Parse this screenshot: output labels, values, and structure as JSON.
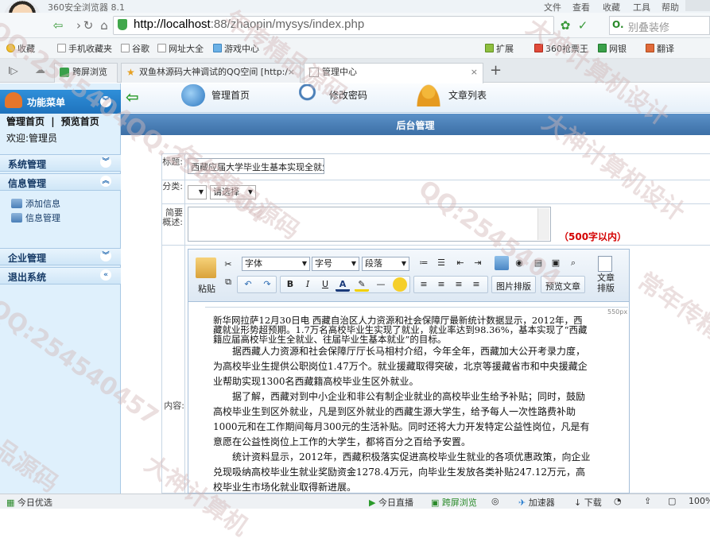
{
  "browser": {
    "app_title": "360安全浏览器 8.1",
    "window_menu": [
      "文件",
      "查看",
      "收藏",
      "工具",
      "帮助"
    ],
    "address": {
      "host": "http://localhost",
      "path": ":88/zhaopin/mysys/index.php"
    },
    "search_placeholder": "别叠装修",
    "bookmarks": [
      "收藏",
      "手机收藏夹",
      "谷歌",
      "网址大全",
      "游戏中心",
      "扩展",
      "360抢票王",
      "网银",
      "翻译"
    ],
    "tabs": [
      {
        "label": "跨屏浏览"
      },
      {
        "label": "双鱼林源码大神调试的QQ空间 [http:/"
      },
      {
        "label": "管理中心"
      }
    ],
    "new_tab": "+",
    "status": {
      "left": "今日优选",
      "items": [
        "今日直播",
        "跨屏浏览",
        "加速器",
        "下载"
      ],
      "zoom": "100%"
    }
  },
  "sidebar": {
    "title": "功能菜单",
    "home_link": "管理首页",
    "separator": "|",
    "preview_link": "预览首页",
    "welcome": "欢迎:管理员",
    "sections": [
      {
        "label": "系统管理",
        "collapsed": true
      },
      {
        "label": "信息管理",
        "collapsed": false,
        "items": [
          "添加信息",
          "信息管理"
        ]
      },
      {
        "label": "企业管理",
        "collapsed": true
      },
      {
        "label": "退出系统",
        "collapsed": true
      }
    ]
  },
  "topnav": {
    "items": [
      "管理首页",
      "修改密码",
      "文章列表"
    ]
  },
  "banner_title": "后台管理",
  "form": {
    "title_label": "标题:",
    "title_value": "西藏应届大学毕业生基本实现全就业",
    "category_label": "分类:",
    "category_value": "",
    "subcategory_value": "请选择",
    "summary_label": "简要概述:",
    "summary_limit": "（500字以内）",
    "content_label": "内容:"
  },
  "editor": {
    "paste_label": "粘贴",
    "font_family": "字体",
    "font_size": "字号",
    "paragraph": "段落",
    "image_layout": "图片排版",
    "preview_article": "预览文章",
    "article_layout": "文章排版",
    "ruler_label": "550px",
    "content": [
      "新华网拉萨12月30日电 西藏自治区人力资源和社会保障厅最新统计数据显示，2012年，西藏就业形势超预期。1.7万名高校毕业生实现了就业，就业率达到98.36%，基本实现了“西藏籍应届高校毕业生全就业、往届毕业生基本就业”的目标。",
      "据西藏人力资源和社会保障厅厅长马相村介绍，今年全年，西藏加大公开考录力度，为高校毕业生提供公职岗位1.47万个。就业援藏取得突破，北京等援藏省市和中央援藏企业帮助实现1300名西藏籍高校毕业生区外就业。",
      "据了解，西藏对到中小企业和非公有制企业就业的高校毕业生给予补贴；同时，鼓励高校毕业生到区外就业，凡是到区外就业的西藏生源大学生，给予每人一次性路费补助1000元和在工作期间每月300元的生活补贴。同时还将大力开发特定公益性岗位，凡是有意愿在公益性岗位上工作的大学生，都将百分之百给予安置。",
      "统计资料显示，2012年，西藏积极落实促进高校毕业生就业的各项优惠政策，向企业兑现吸纳高校毕业生就业奖励资金1278.4万元，向毕业生发放各类补贴247.12万元，高校毕业生市场化就业取得新进展。"
    ]
  },
  "watermarks": [
    "QQ:2545404",
    "年传精品源码",
    "大神计算机设计",
    "QQ:2545404",
    "年传精品源码",
    "QQ:2545404",
    "大神计算机设计",
    "常年传精品源码",
    "QQ:254540457",
    "品源码",
    "大神计算机"
  ]
}
